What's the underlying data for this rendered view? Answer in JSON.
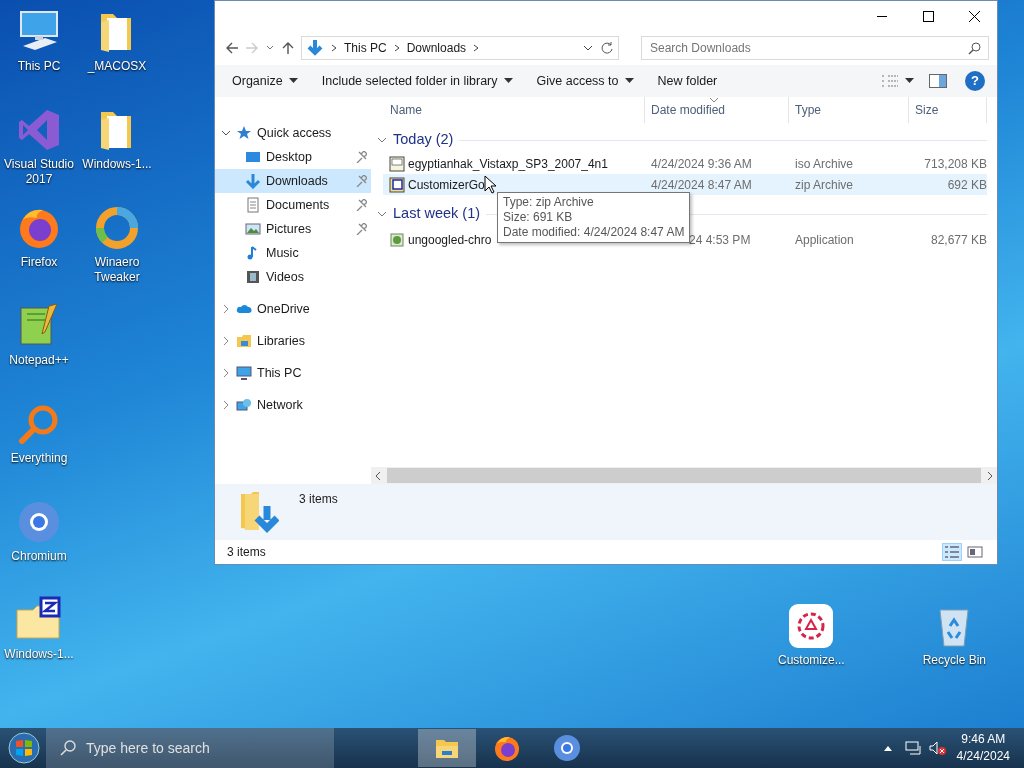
{
  "desktop_icons": [
    {
      "label": "This PC",
      "kind": "pc"
    },
    {
      "label": "Visual Studio 2017",
      "kind": "vs"
    },
    {
      "label": "Firefox",
      "kind": "firefox"
    },
    {
      "label": "Notepad++",
      "kind": "notepad"
    },
    {
      "label": "Everything",
      "kind": "magnifier"
    },
    {
      "label": "Chromium",
      "kind": "chromium"
    },
    {
      "label": "Windows-1...",
      "kind": "zipfolder"
    },
    {
      "label": "_MACOSX",
      "kind": "folder"
    },
    {
      "label": "Windows-1...",
      "kind": "folder"
    },
    {
      "label": "Winaero Tweaker",
      "kind": "winaero"
    }
  ],
  "desktop_icons_right": [
    {
      "label": "Customize...",
      "kind": "gearapp"
    },
    {
      "label": "Recycle Bin",
      "kind": "recycle"
    }
  ],
  "window": {
    "address": {
      "segments": [
        "This PC",
        "Downloads"
      ]
    },
    "search": {
      "placeholder": "Search Downloads"
    },
    "toolbar": [
      {
        "label": "Organize",
        "dropdown": true
      },
      {
        "label": "Include selected folder in library",
        "dropdown": true
      },
      {
        "label": "Give access to",
        "dropdown": true
      },
      {
        "label": "New folder",
        "dropdown": false
      }
    ],
    "help_label": "?",
    "nav_pane": [
      {
        "label": "Quick access",
        "kind": "star",
        "expanded": true,
        "selected": false,
        "children": [
          {
            "label": "Desktop",
            "kind": "desktop",
            "pinned": true,
            "selected": false
          },
          {
            "label": "Downloads",
            "kind": "downloads",
            "pinned": true,
            "selected": true
          },
          {
            "label": "Documents",
            "kind": "documents",
            "pinned": true,
            "selected": false
          },
          {
            "label": "Pictures",
            "kind": "pictures",
            "pinned": true,
            "selected": false
          },
          {
            "label": "Music",
            "kind": "music",
            "pinned": false,
            "selected": false
          },
          {
            "label": "Videos",
            "kind": "videos",
            "pinned": false,
            "selected": false
          }
        ]
      },
      {
        "label": "OneDrive",
        "kind": "cloud",
        "expanded": false,
        "selected": false
      },
      {
        "label": "Libraries",
        "kind": "libraries",
        "expanded": false,
        "selected": false
      },
      {
        "label": "This PC",
        "kind": "pc",
        "expanded": false,
        "selected": false
      },
      {
        "label": "Network",
        "kind": "network",
        "expanded": false,
        "selected": false
      }
    ],
    "columns": [
      {
        "label": "Name",
        "sorted": false
      },
      {
        "label": "Date modified",
        "sorted": true
      },
      {
        "label": "Type",
        "sorted": false
      },
      {
        "label": "Size",
        "sorted": false
      }
    ],
    "groups": [
      {
        "label": "Today (2)",
        "expanded": true,
        "files": [
          {
            "name": "egyptianhak_Vistaxp_SP3_2007_4n1",
            "date": "4/24/2024 9:36 AM",
            "type": "iso Archive",
            "size": "713,208 KB",
            "kind": "iso",
            "hovered": false
          },
          {
            "name": "CustomizerGo",
            "date": "4/24/2024 8:47 AM",
            "type": "zip Archive",
            "size": "692 KB",
            "kind": "zip",
            "hovered": true
          }
        ]
      },
      {
        "label": "Last week (1)",
        "expanded": true,
        "files": [
          {
            "name": "ungoogled-chro",
            "date": "24 4:53 PM",
            "type": "Application",
            "size": "82,677 KB",
            "kind": "app",
            "hovered": false
          }
        ]
      }
    ],
    "tooltip": {
      "lines": [
        "Type: zip Archive",
        "Size: 691 KB",
        "Date modified: 4/24/2024 8:47 AM"
      ]
    },
    "details_pane": {
      "summary": "3 items"
    },
    "status_bar": {
      "text": "3 items",
      "views": [
        {
          "kind": "details",
          "selected": true
        },
        {
          "kind": "tiles",
          "selected": false
        }
      ]
    }
  },
  "taskbar": {
    "search": {
      "placeholder": "Type here to search"
    },
    "apps": [
      {
        "kind": "explorer",
        "active": true
      },
      {
        "kind": "firefox",
        "active": false
      },
      {
        "kind": "chromium",
        "active": false
      }
    ],
    "time": "9:46 AM",
    "date": "4/24/2024"
  }
}
